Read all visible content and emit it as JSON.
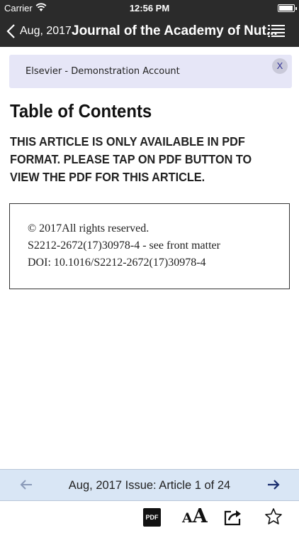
{
  "status_bar": {
    "carrier": "Carrier",
    "time": "12:56 PM"
  },
  "nav": {
    "back_label": "Aug, 2017",
    "title": "Journal of the Academy of Nut..."
  },
  "banner": {
    "text": "Elsevier - Demonstration Account",
    "close_label": "X"
  },
  "content": {
    "toc_title": "Table of Contents",
    "notice": "THIS ARTICLE IS ONLY AVAILABLE IN PDF FORMAT. PLEASE TAP ON PDF BUTTON TO VIEW THE PDF FOR THIS ARTICLE.",
    "info_lines": [
      "© 2017All rights reserved.",
      "S2212-2672(17)30978-4 - see front matter",
      "DOI: 10.1016/S2212-2672(17)30978-4"
    ]
  },
  "issue_bar": {
    "label": "Aug, 2017 Issue: Article 1 of 24",
    "prev_icon": "arrow-left-icon",
    "next_icon": "arrow-right-icon"
  },
  "toolbar": {
    "pdf_label": "PDF",
    "font_small": "A",
    "font_big": "A",
    "share_icon": "share-icon",
    "star_icon": "star-icon"
  },
  "colors": {
    "bar_dark": "#2b2b2b",
    "banner_bg": "#e6e6f7",
    "issue_bar_bg": "#d9e6f5",
    "next_arrow": "#1a2e6e",
    "prev_arrow": "#8a9ab8"
  }
}
